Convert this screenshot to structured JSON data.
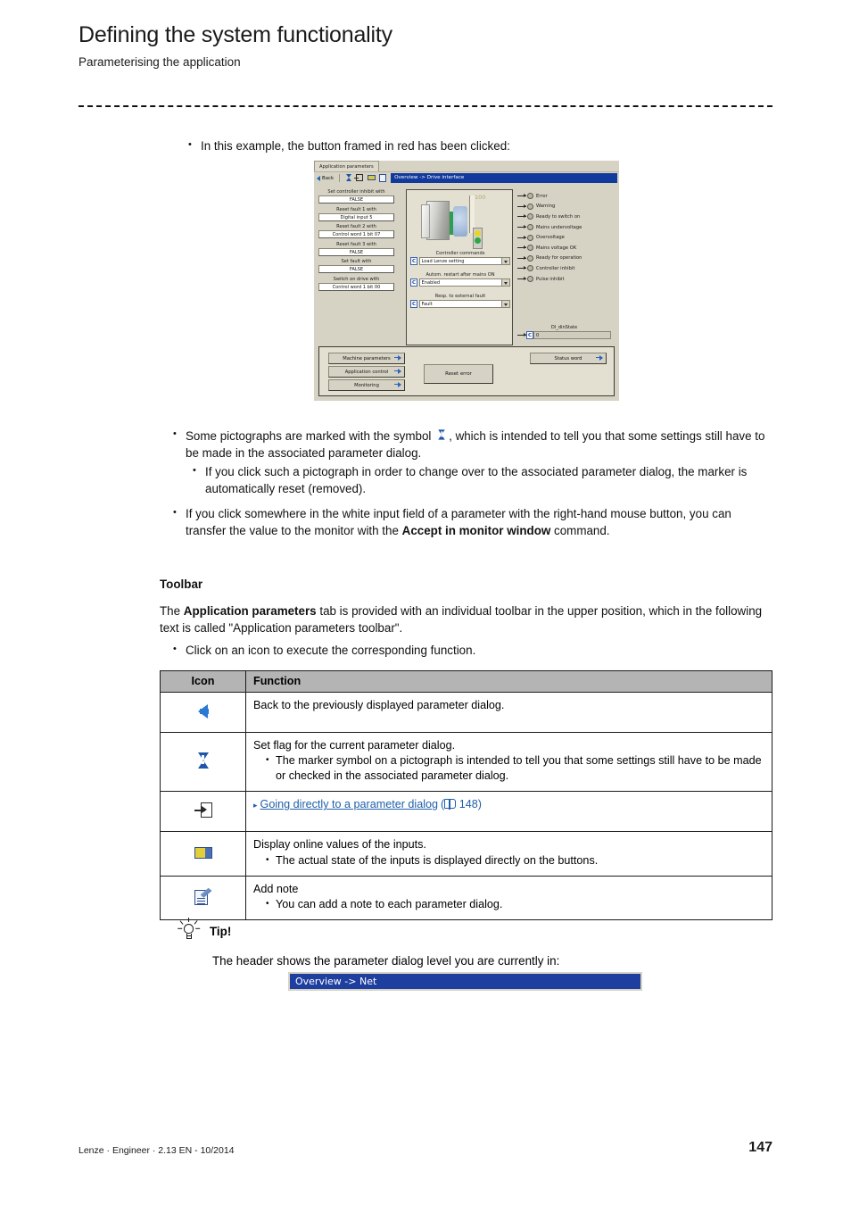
{
  "header": {
    "title": "Defining the system functionality",
    "subtitle": "Parameterising the application"
  },
  "intro_bullet": "In this example, the button framed in red has been clicked:",
  "app_screenshot": {
    "tab_label": "Application parameters",
    "back_label": "Back",
    "breadcrumb": "Overview -> Drive interface",
    "toolbar_icons": [
      "back-arrow-icon",
      "flag-icon",
      "jump-to-dialog-icon",
      "online-values-icon",
      "add-note-icon"
    ],
    "left_params": [
      {
        "label": "Set controller inhibit with",
        "value": "FALSE"
      },
      {
        "label": "Reset fault 1 with",
        "value": "Digital input 5"
      },
      {
        "label": "Reset fault 2 with",
        "value": "Control word 1 bit 07"
      },
      {
        "label": "Reset fault 3 with",
        "value": "FALSE"
      },
      {
        "label": "Set fault with",
        "value": "FALSE"
      },
      {
        "label": "Switch on drive with",
        "value": "Control word 1 bit 00"
      }
    ],
    "scale_value": "100",
    "center_selects": [
      {
        "label": "Controller commands",
        "value": "Load Lenze setting",
        "prefix": "C"
      },
      {
        "label": "Autom. restart after mains ON",
        "value": "Enabled",
        "prefix": "C"
      },
      {
        "label": "Resp. to external fault",
        "value": "Fault",
        "prefix": "C"
      }
    ],
    "status_leds": [
      "Error",
      "Warning",
      "Ready to switch on",
      "Mains undervoltage",
      "Overvoltage",
      "Mains voltage OK",
      "Ready for operation",
      "Controller inhibit",
      "Pulse inhibit"
    ],
    "dinstate": {
      "label": "DI_dinState",
      "value": "0",
      "prefix": "C"
    },
    "nav_buttons": [
      "Machine parameters",
      "Application control",
      "Monitoring"
    ],
    "reset_button": "Reset error",
    "status_word_button": "Status word"
  },
  "pictograph_bullets": {
    "main_prefix": "Some pictographs are marked with the symbol",
    "main_suffix": ", which is intended to tell you that some settings still have to be made in the associated parameter dialog.",
    "sub": "If you click such a pictograph in order to change over to the associated parameter dialog, the marker is automatically reset (removed)."
  },
  "right_click_bullet": {
    "part1": "If you click somewhere in the white input field of a parameter with the right-hand mouse button, you can transfer the value to the monitor with the ",
    "bold": "Accept in monitor window",
    "part2": " command."
  },
  "toolbar_section": {
    "heading": "Toolbar",
    "para_pre": "The ",
    "para_bold": "Application parameters",
    "para_post": " tab is provided with an individual toolbar in the upper position, which in the following text is called \"Application parameters toolbar\".",
    "bullet": "Click on an icon to execute the corresponding function."
  },
  "table": {
    "columns": [
      "Icon",
      "Function"
    ],
    "rows": [
      {
        "icon": "back-arrow-icon",
        "lines": [
          "Back to the previously displayed parameter dialog."
        ],
        "subs": []
      },
      {
        "icon": "flag-icon",
        "lines": [
          "Set flag for the current parameter dialog."
        ],
        "subs": [
          "The marker symbol on a pictograph is intended to tell you that some settings still have to be made or checked in the associated parameter dialog."
        ]
      },
      {
        "icon": "jump-to-dialog-icon",
        "link": "Going directly to a parameter dialog",
        "link_page": "148",
        "lines": [],
        "subs": []
      },
      {
        "icon": "online-values-icon",
        "lines": [
          "Display online values of the inputs."
        ],
        "subs": [
          "The actual state of the inputs is displayed directly on the buttons."
        ]
      },
      {
        "icon": "add-note-icon",
        "lines": [
          "Add note"
        ],
        "subs": [
          "You can add a note to each parameter dialog."
        ]
      }
    ]
  },
  "tip": {
    "label": "Tip!",
    "text": "The header shows the parameter dialog level you are currently in:",
    "dialog_header": "Overview -> Net"
  },
  "footer": {
    "left": "Lenze · Engineer · 2.13 EN - 10/2014",
    "page": "147"
  },
  "colors": {
    "accent_blue": "#1f5fa8",
    "title_bar_blue": "#12399c",
    "table_header_gray": "#b4b4b4",
    "app_bg": "#d6d3c4"
  }
}
